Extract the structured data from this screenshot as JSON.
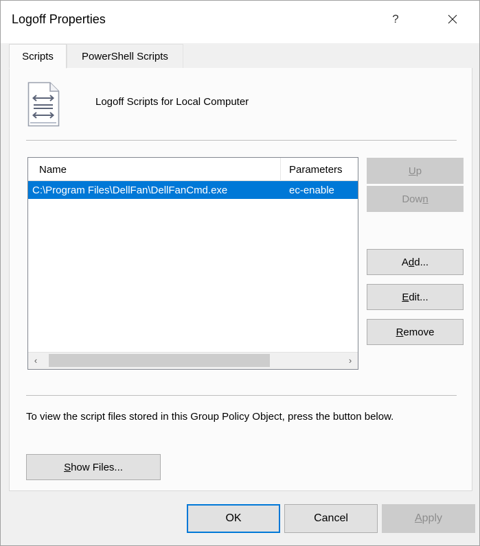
{
  "window": {
    "title": "Logoff Properties",
    "help_icon": "question-mark-icon",
    "close_icon": "close-icon"
  },
  "tabs": [
    {
      "label": "Scripts",
      "active": true
    },
    {
      "label": "PowerShell Scripts",
      "active": false
    }
  ],
  "panel": {
    "icon": "script-document-icon",
    "heading": "Logoff Scripts for Local Computer"
  },
  "listview": {
    "columns": [
      {
        "label": "Name"
      },
      {
        "label": "Parameters"
      }
    ],
    "rows": [
      {
        "name": "C:\\Program Files\\DellFan\\DellFanCmd.exe",
        "parameters": "ec-enable",
        "selected": true
      }
    ],
    "scrollbar": {
      "left_arrow": "‹",
      "right_arrow": "›"
    }
  },
  "side_buttons": [
    {
      "id": "up",
      "prefix": "U",
      "accel": "",
      "suffix": "p",
      "label": "Up",
      "disabled": true
    },
    {
      "id": "down",
      "prefix": "Dow",
      "accel": "n",
      "suffix": "",
      "label": "Down",
      "disabled": true
    },
    {
      "id": "add",
      "prefix": "A",
      "accel": "d",
      "suffix": "d...",
      "label": "Add...",
      "disabled": false
    },
    {
      "id": "edit",
      "prefix": "",
      "accel": "E",
      "suffix": "dit...",
      "label": "Edit...",
      "disabled": false
    },
    {
      "id": "remove",
      "prefix": "",
      "accel": "R",
      "suffix": "emove",
      "label": "Remove",
      "disabled": false
    }
  ],
  "footer_section": {
    "description": "To view the script files stored in this Group Policy Object, press the button below.",
    "show_files": {
      "prefix": "",
      "accel": "S",
      "suffix": "how Files...",
      "label": "Show Files..."
    }
  },
  "footer": {
    "ok": "OK",
    "cancel": "Cancel",
    "apply_accel": "A",
    "apply_rest": "pply",
    "apply_label": "Apply"
  },
  "colors": {
    "accent": "#0078d7",
    "selection": "#0078d7",
    "button_face": "#e1e1e1",
    "disabled_face": "#cccccc",
    "disabled_text": "#8d8d8d",
    "panel_bg": "#fbfbfb",
    "dialog_bg": "#f0f0f0"
  }
}
